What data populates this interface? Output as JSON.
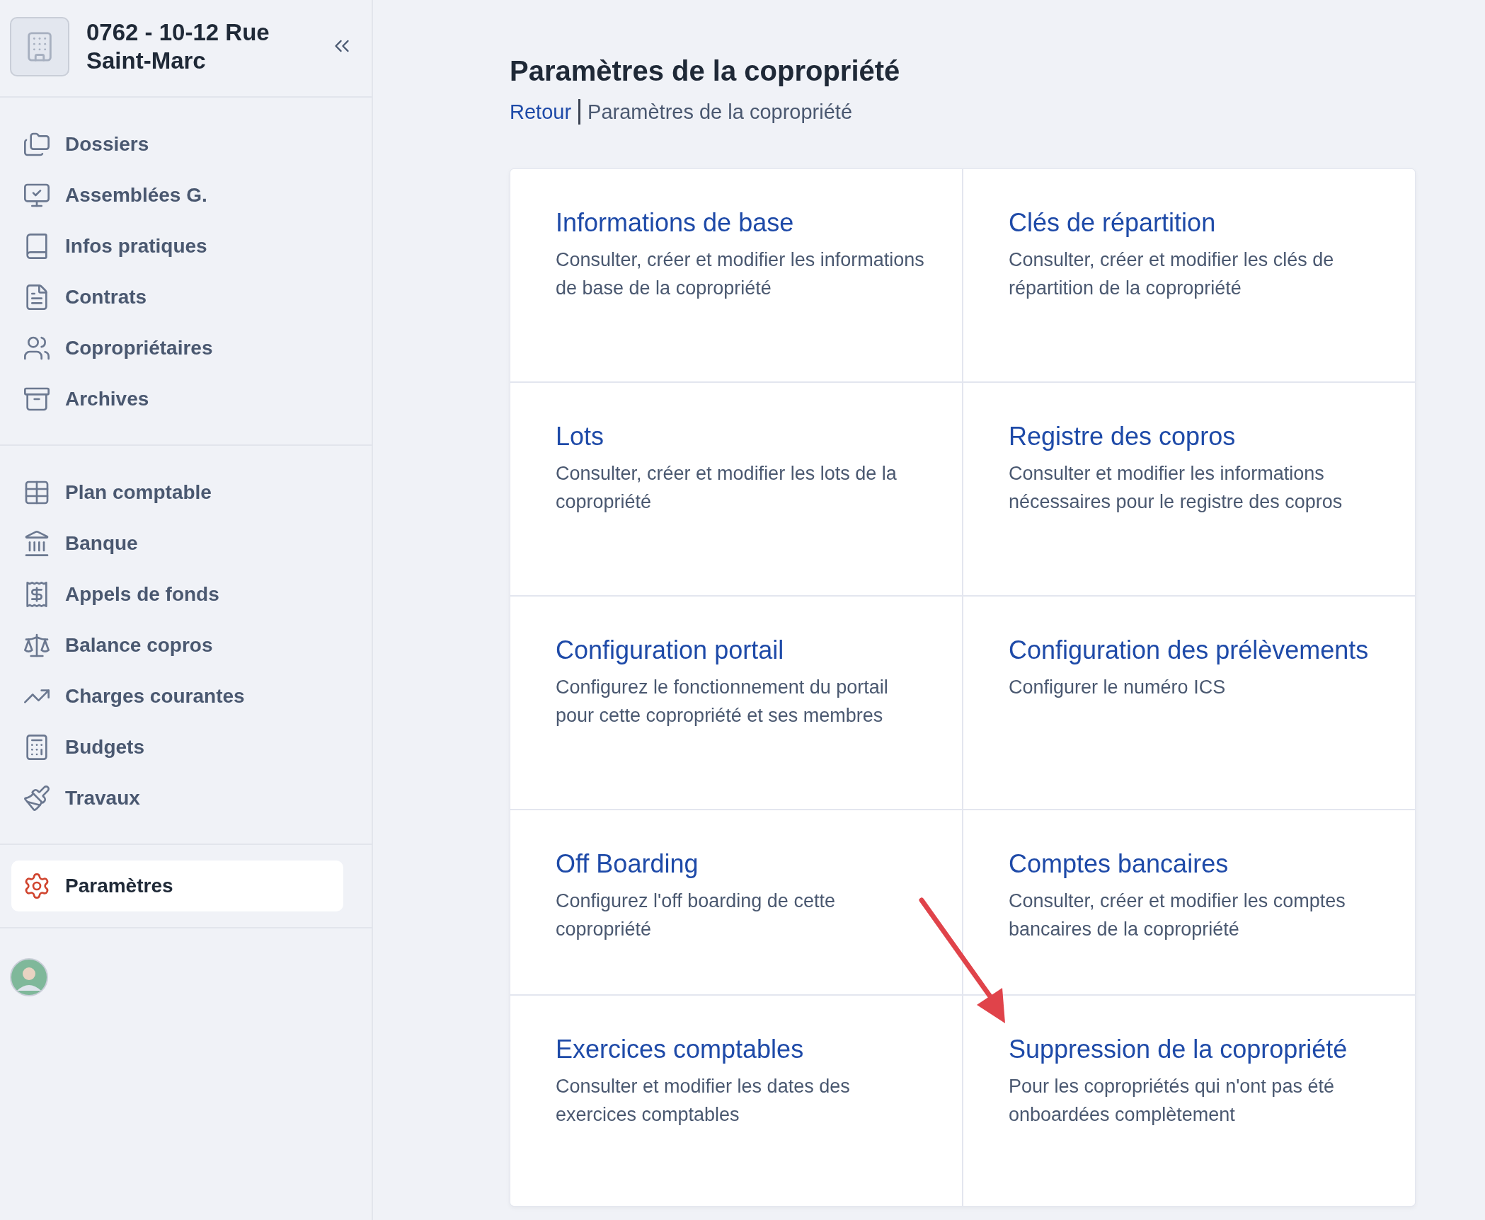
{
  "sidebar": {
    "title": "0762 - 10-12 Rue Saint-Marc",
    "nav_groups": [
      [
        {
          "label": "Dossiers",
          "selected": false
        },
        {
          "label": "Assemblées G.",
          "selected": false
        },
        {
          "label": "Infos pratiques",
          "selected": false
        },
        {
          "label": "Contrats",
          "selected": false
        },
        {
          "label": "Copropriétaires",
          "selected": false
        },
        {
          "label": "Archives",
          "selected": false
        }
      ],
      [
        {
          "label": "Plan comptable",
          "selected": false
        },
        {
          "label": "Banque",
          "selected": false
        },
        {
          "label": "Appels de fonds",
          "selected": false
        },
        {
          "label": "Balance copros",
          "selected": false
        },
        {
          "label": "Charges courantes",
          "selected": false
        },
        {
          "label": "Budgets",
          "selected": false
        },
        {
          "label": "Travaux",
          "selected": false
        }
      ],
      [
        {
          "label": "Paramètres",
          "selected": true
        }
      ]
    ]
  },
  "page": {
    "title": "Paramètres de la copropriété",
    "breadcrumb": {
      "back": "Retour",
      "current": "Paramètres de la copropriété"
    }
  },
  "cards": [
    {
      "title": "Informations de base",
      "description": "Consulter, créer et modifier les informations de base de la copropriété"
    },
    {
      "title": "Clés de répartition",
      "description": "Consulter, créer et modifier les clés de répartition de la copropriété"
    },
    {
      "title": "Lots",
      "description": "Consulter, créer et modifier les lots de la copropriété"
    },
    {
      "title": "Registre des copros",
      "description": "Consulter et modifier les informations nécessaires pour le registre des copros"
    },
    {
      "title": "Configuration portail",
      "description": "Configurez le fonctionnement du portail pour cette copropriété et ses membres"
    },
    {
      "title": "Configuration des prélèvements",
      "description": "Configurer le numéro ICS"
    },
    {
      "title": "Off Boarding",
      "description": "Configurez l'off boarding de cette copropriété"
    },
    {
      "title": "Comptes bancaires",
      "description": "Consulter, créer et modifier les comptes bancaires de la copropriété"
    },
    {
      "title": "Exercices comptables",
      "description": "Consulter et modifier les dates des exercices comptables"
    },
    {
      "title": "Suppression de la copropriété",
      "description": "Pour les copropriétés qui n'ont pas été onboardées complètement"
    }
  ]
}
